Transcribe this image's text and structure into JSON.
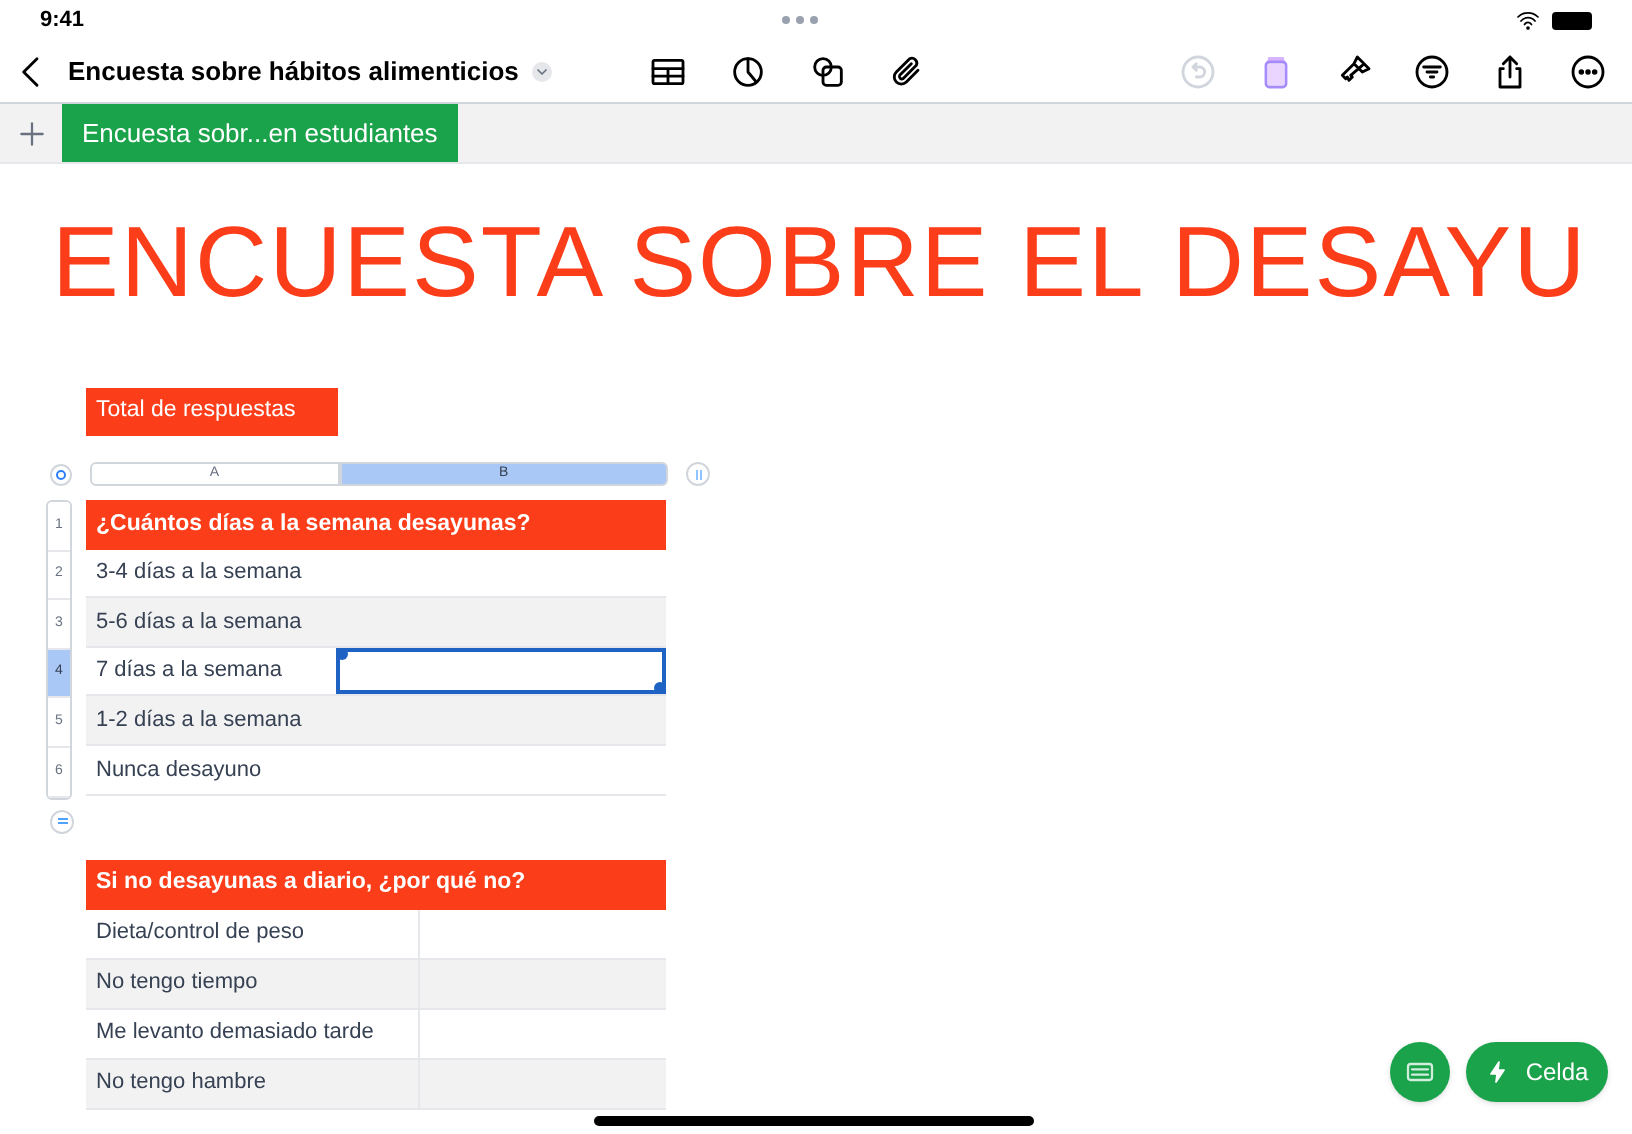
{
  "status_bar": {
    "time": "9:41"
  },
  "toolbar": {
    "title": "Encuesta sobre hábitos alimenticios",
    "undo_disabled": true
  },
  "sheet_tabs": [
    {
      "label": "Encuesta sobr...en estudiantes",
      "selected": true
    }
  ],
  "title": "ENCUESTA SOBRE EL DESAYU",
  "label_box": "Total de respuestas",
  "table_1": {
    "columns": [
      {
        "label": "A",
        "selected": false
      },
      {
        "label": "B",
        "selected": true
      }
    ],
    "rows": [
      {
        "number": "1",
        "kind": "header",
        "text": "¿Cuántos días a la semana desayunas?",
        "selected": false
      },
      {
        "number": "2",
        "kind": "data",
        "text": "3-4 días a la semana",
        "selected": false
      },
      {
        "number": "3",
        "kind": "data",
        "text": "5-6 días a la semana",
        "selected": false
      },
      {
        "number": "4",
        "kind": "data",
        "text": "7 días a la semana",
        "selected": true
      },
      {
        "number": "5",
        "kind": "data",
        "text": "1-2 días a la semana",
        "selected": false
      },
      {
        "number": "6",
        "kind": "data",
        "text": "Nunca desayuno",
        "selected": false
      }
    ]
  },
  "table_2": {
    "header": "Si no desayunas a diario, ¿por qué no?",
    "rows": [
      "Dieta/control de peso",
      "No tengo tiempo",
      "Me levanto demasiado tarde",
      "No tengo hambre"
    ]
  },
  "cell_button": {
    "label": "Celda"
  }
}
